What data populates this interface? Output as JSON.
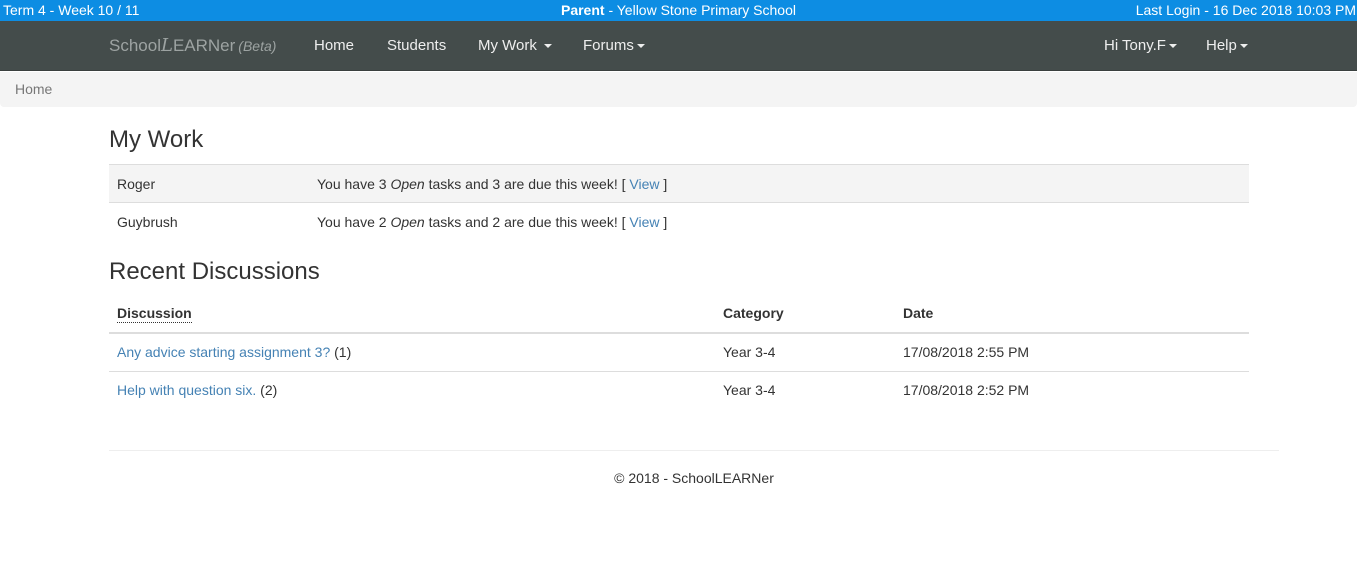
{
  "infobar": {
    "term": "Term 4 - Week 10 / 11",
    "role": "Parent",
    "school": " - Yellow Stone Primary School",
    "last_login": "Last Login - 16 Dec 2018 10:03 PM"
  },
  "navbar": {
    "brand_prefix": "School",
    "brand_script": "L",
    "brand_suffix": "EARNer",
    "brand_beta": "(Beta)",
    "items": {
      "home": "Home",
      "students": "Students",
      "my_work": "My Work",
      "forums": "Forums",
      "user": "Hi Tony.F",
      "help": "Help"
    }
  },
  "breadcrumb": {
    "home": "Home"
  },
  "my_work": {
    "title": "My Work",
    "rows": [
      {
        "name": "Roger",
        "prefix": "You have 3 ",
        "status": "Open",
        "suffix": " tasks and 3 are due this week! [ ",
        "link": "View",
        "end": " ]"
      },
      {
        "name": "Guybrush",
        "prefix": "You have 2 ",
        "status": "Open",
        "suffix": " tasks and 2 are due this week! [ ",
        "link": "View",
        "end": " ]"
      }
    ]
  },
  "recent_discussions": {
    "title": "Recent Discussions",
    "headers": {
      "discussion": "Discussion",
      "category": "Category",
      "date": "Date"
    },
    "rows": [
      {
        "title": "Any advice starting assignment 3?",
        "count": " (1)",
        "category": "Year 3-4",
        "date": "17/08/2018 2:55 PM"
      },
      {
        "title": "Help with question six.",
        "count": " (2)",
        "category": "Year 3-4",
        "date": "17/08/2018 2:52 PM"
      }
    ]
  },
  "footer": {
    "text": "© 2018 - SchoolLEARNer"
  },
  "colors": {
    "infobar_bg": "#0d8de3",
    "navbar_bg": "#444c4b",
    "link": "#4582b4",
    "stripe": "#f4f4f4"
  }
}
